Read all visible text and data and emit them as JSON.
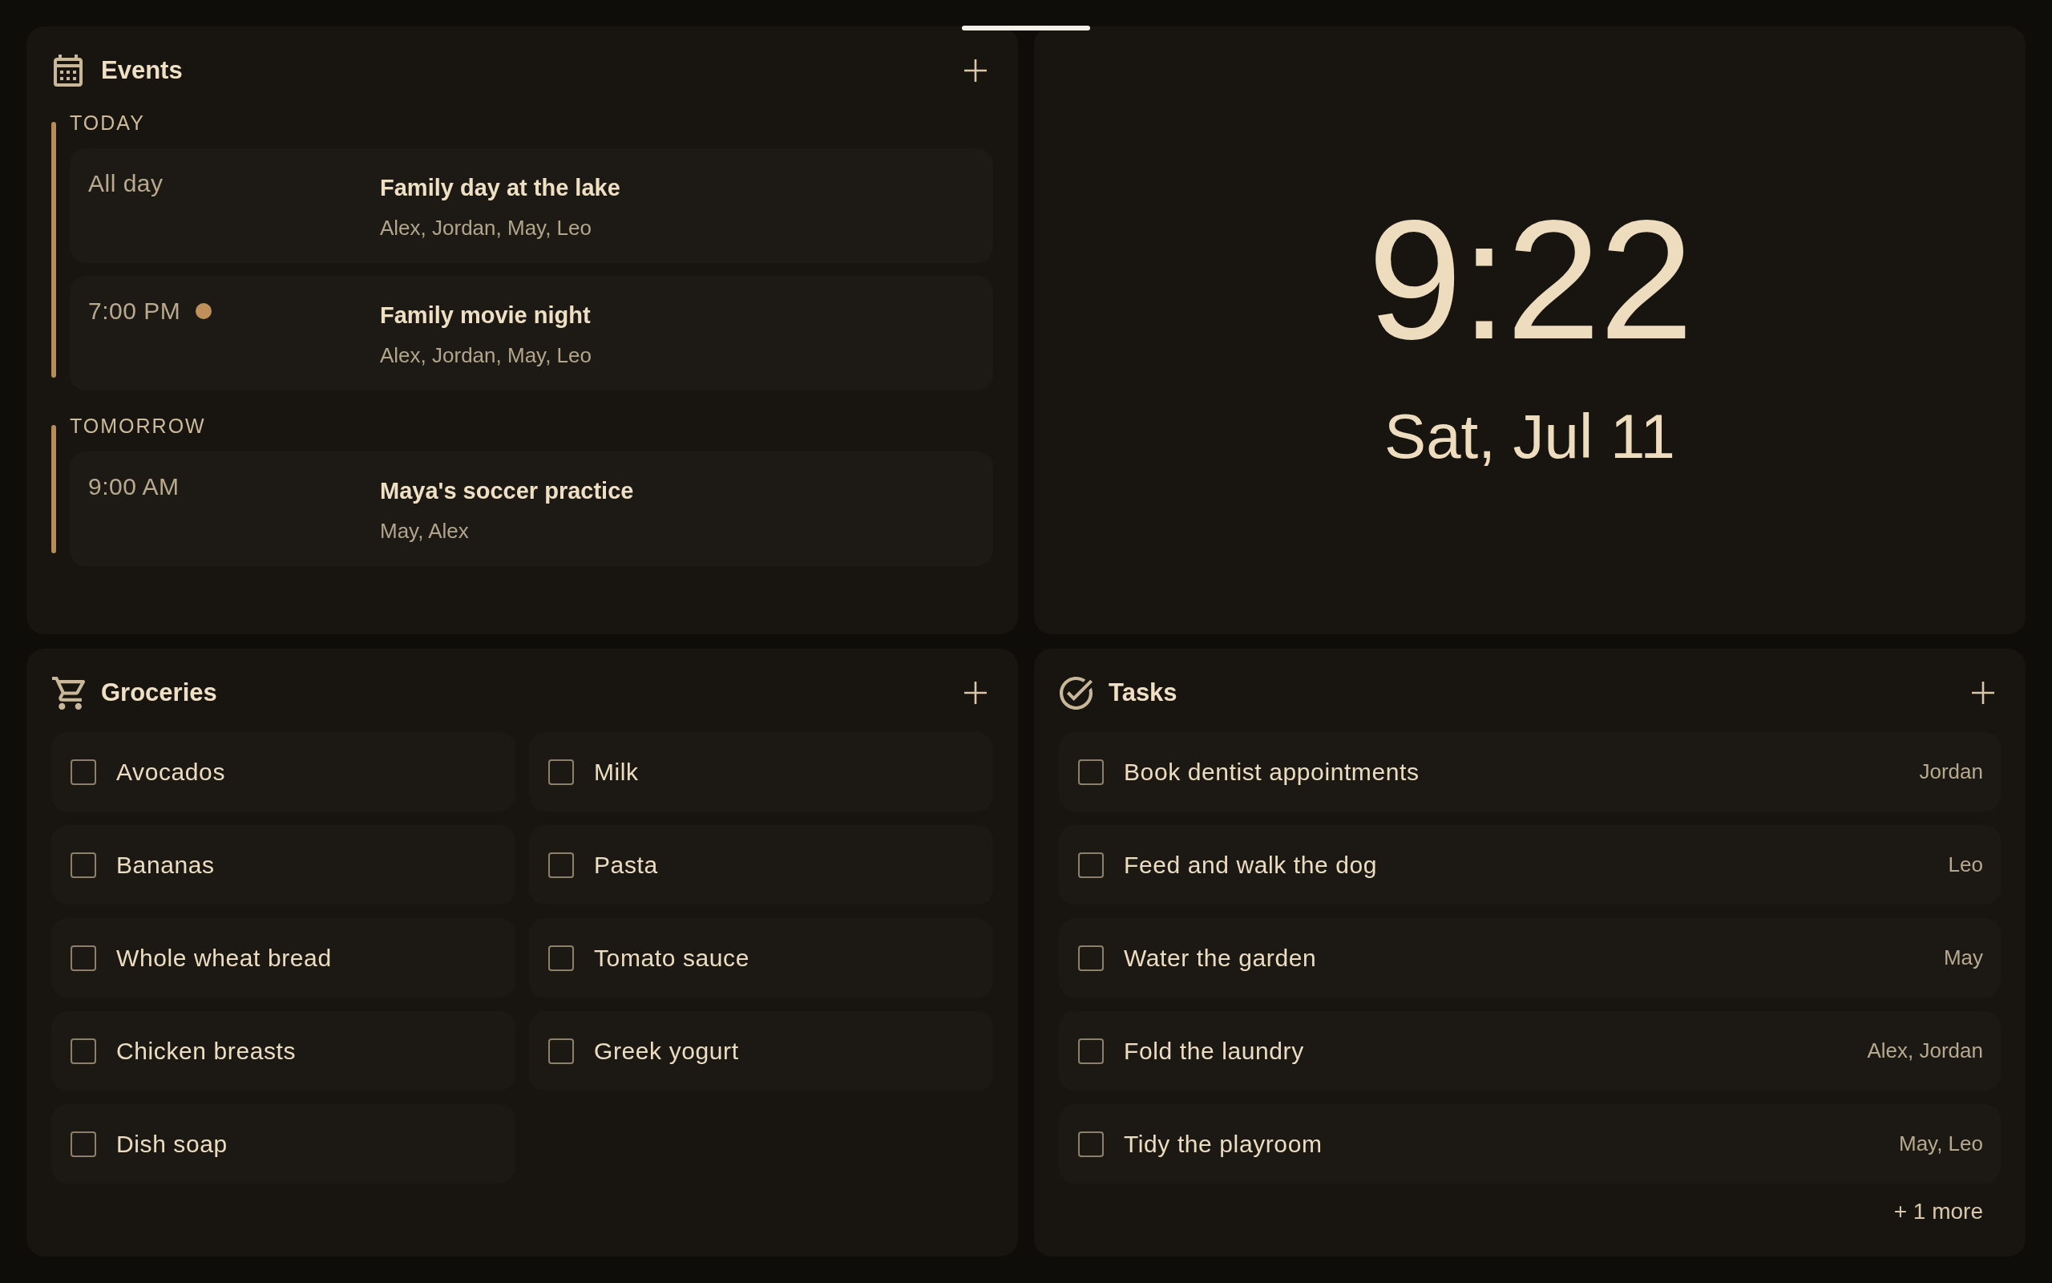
{
  "events": {
    "title": "Events",
    "groups": [
      {
        "label": "TODAY",
        "items": [
          {
            "time": "All day",
            "title": "Family day at the lake",
            "attendees": "Alex, Jordan, May, Leo",
            "dot": false
          },
          {
            "time": "7:00 PM",
            "title": "Family movie night",
            "attendees": "Alex, Jordan, May, Leo",
            "dot": true
          }
        ]
      },
      {
        "label": "TOMORROW",
        "items": [
          {
            "time": "9:00 AM",
            "title": "Maya's soccer practice",
            "attendees": "May, Alex",
            "dot": false
          }
        ]
      }
    ]
  },
  "clock": {
    "time": "9:22",
    "date": "Sat, Jul 11"
  },
  "groceries": {
    "title": "Groceries",
    "items": [
      {
        "label": "Avocados",
        "checked": false
      },
      {
        "label": "Milk",
        "checked": false
      },
      {
        "label": "Bananas",
        "checked": false
      },
      {
        "label": "Pasta",
        "checked": false
      },
      {
        "label": "Whole wheat bread",
        "checked": false
      },
      {
        "label": "Tomato sauce",
        "checked": false
      },
      {
        "label": "Chicken breasts",
        "checked": false
      },
      {
        "label": "Greek yogurt",
        "checked": false
      },
      {
        "label": "Dish soap",
        "checked": false
      }
    ]
  },
  "tasks": {
    "title": "Tasks",
    "items": [
      {
        "label": "Book dentist appointments",
        "assignee": "Jordan",
        "checked": false
      },
      {
        "label": "Feed and walk the dog",
        "assignee": "Leo",
        "checked": false
      },
      {
        "label": "Water the garden",
        "assignee": "May",
        "checked": false
      },
      {
        "label": "Fold the laundry",
        "assignee": "Alex, Jordan",
        "checked": false
      },
      {
        "label": "Tidy the playroom",
        "assignee": "May, Leo",
        "checked": false
      }
    ],
    "more": "+ 1 more"
  }
}
